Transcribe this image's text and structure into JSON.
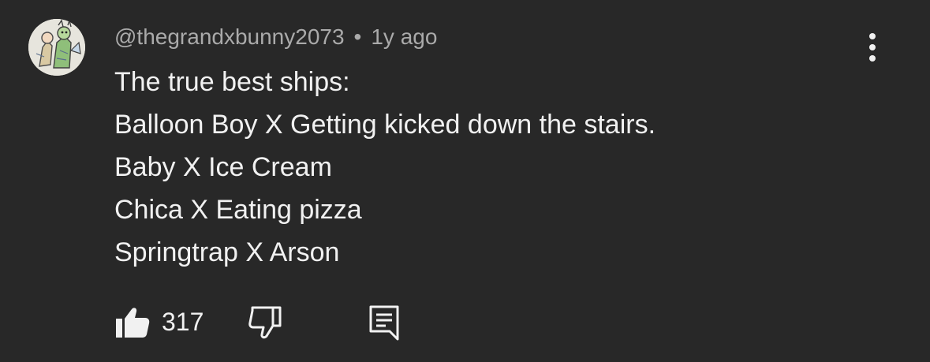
{
  "comment": {
    "username": "@thegrandxbunny2073",
    "separator": "•",
    "time": "1y ago",
    "lines": [
      "The true best ships:",
      "Balloon Boy X Getting kicked down the stairs.",
      "Baby X Ice Cream",
      "Chica X Eating pizza",
      "Springtrap X Arson"
    ],
    "like_count": "317"
  },
  "icons": {
    "avatar": "drawn-character-avatar",
    "more": "vertical-ellipsis-icon",
    "like": "thumbs-up-filled-icon",
    "dislike": "thumbs-down-outline-icon",
    "reply": "comment-reply-icon"
  },
  "colors": {
    "background": "#282828",
    "text": "#f1f1f1",
    "secondary_text": "#aaaaaa"
  }
}
